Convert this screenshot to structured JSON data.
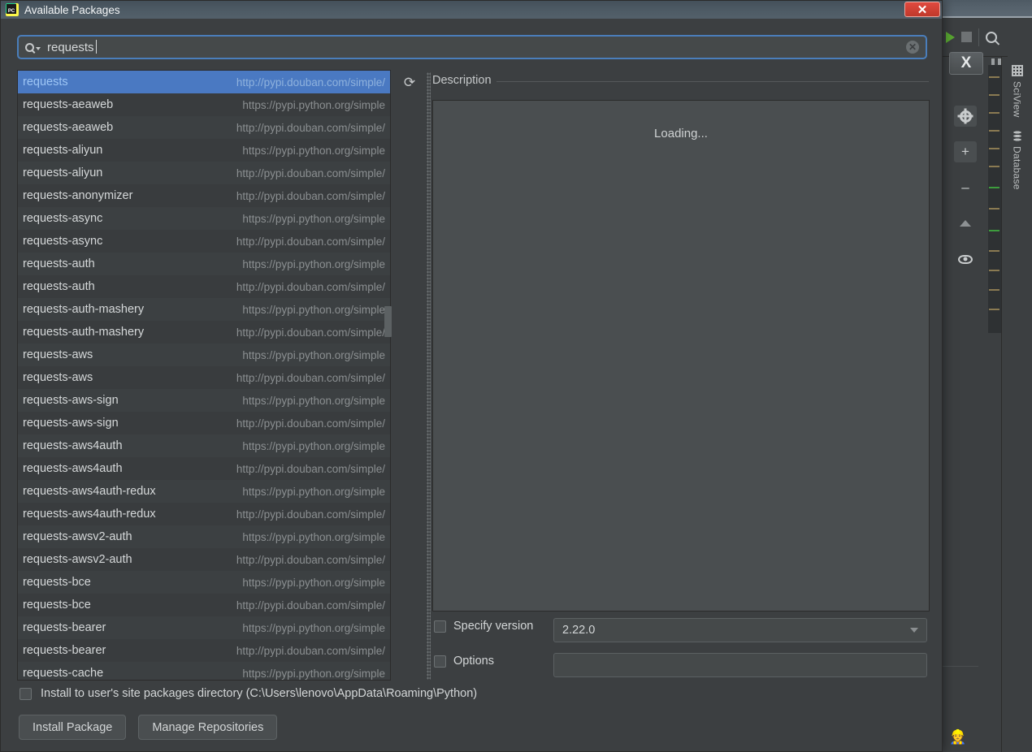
{
  "ide": {
    "right_tabs": [
      {
        "label": "SciView",
        "icon": "grid-icon"
      },
      {
        "label": "Database",
        "icon": "database-icon"
      }
    ],
    "toolbar_icons": [
      "run-icon",
      "stop-icon",
      "search-icon"
    ],
    "side_icons": [
      "gear-icon",
      "plus-icon",
      "minus-icon",
      "triangle-up-icon",
      "eye-icon"
    ],
    "close_tool_label": "X",
    "plus_label": "+",
    "minus_label": "–",
    "person_icon_label": "👷"
  },
  "dialog": {
    "title": "Available Packages",
    "app_icon": "pycharm-icon",
    "close_label": "✕"
  },
  "search": {
    "value": "requests",
    "icon": "search-icon",
    "clear_icon": "✕",
    "clear_label": "✕"
  },
  "list": {
    "refresh_icon": "⟳",
    "repos": {
      "douban": "http://pypi.douban.com/simple/",
      "pypi": "https://pypi.python.org/simple"
    },
    "selected_index": 0,
    "rows": [
      {
        "name": "requests",
        "repo": "http://pypi.douban.com/simple/"
      },
      {
        "name": "requests-aeaweb",
        "repo": "https://pypi.python.org/simple"
      },
      {
        "name": "requests-aeaweb",
        "repo": "http://pypi.douban.com/simple/"
      },
      {
        "name": "requests-aliyun",
        "repo": "https://pypi.python.org/simple"
      },
      {
        "name": "requests-aliyun",
        "repo": "http://pypi.douban.com/simple/"
      },
      {
        "name": "requests-anonymizer",
        "repo": "http://pypi.douban.com/simple/"
      },
      {
        "name": "requests-async",
        "repo": "https://pypi.python.org/simple"
      },
      {
        "name": "requests-async",
        "repo": "http://pypi.douban.com/simple/"
      },
      {
        "name": "requests-auth",
        "repo": "https://pypi.python.org/simple"
      },
      {
        "name": "requests-auth",
        "repo": "http://pypi.douban.com/simple/"
      },
      {
        "name": "requests-auth-mashery",
        "repo": "https://pypi.python.org/simple"
      },
      {
        "name": "requests-auth-mashery",
        "repo": "http://pypi.douban.com/simple/"
      },
      {
        "name": "requests-aws",
        "repo": "https://pypi.python.org/simple"
      },
      {
        "name": "requests-aws",
        "repo": "http://pypi.douban.com/simple/"
      },
      {
        "name": "requests-aws-sign",
        "repo": "https://pypi.python.org/simple"
      },
      {
        "name": "requests-aws-sign",
        "repo": "http://pypi.douban.com/simple/"
      },
      {
        "name": "requests-aws4auth",
        "repo": "https://pypi.python.org/simple"
      },
      {
        "name": "requests-aws4auth",
        "repo": "http://pypi.douban.com/simple/"
      },
      {
        "name": "requests-aws4auth-redux",
        "repo": "https://pypi.python.org/simple"
      },
      {
        "name": "requests-aws4auth-redux",
        "repo": "http://pypi.douban.com/simple/"
      },
      {
        "name": "requests-awsv2-auth",
        "repo": "https://pypi.python.org/simple"
      },
      {
        "name": "requests-awsv2-auth",
        "repo": "http://pypi.douban.com/simple/"
      },
      {
        "name": "requests-bce",
        "repo": "https://pypi.python.org/simple"
      },
      {
        "name": "requests-bce",
        "repo": "http://pypi.douban.com/simple/"
      },
      {
        "name": "requests-bearer",
        "repo": "https://pypi.python.org/simple"
      },
      {
        "name": "requests-bearer",
        "repo": "http://pypi.douban.com/simple/"
      },
      {
        "name": "requests-cache",
        "repo": "https://pypi.python.org/simple"
      }
    ]
  },
  "description": {
    "label": "Description",
    "content": "Loading..."
  },
  "version": {
    "checkbox_label": "Specify version",
    "checked": false,
    "selected": "2.22.0"
  },
  "options": {
    "checkbox_label": "Options",
    "checked": false,
    "value": ""
  },
  "site_packages": {
    "label": "Install to user's site packages directory (C:\\Users\\lenovo\\AppData\\Roaming\\Python)",
    "checked": false
  },
  "buttons": {
    "install": "Install Package",
    "manage": "Manage Repositories"
  },
  "colors": {
    "accent_selection": "#4a79c2",
    "window_bg": "#3c3f41",
    "close_red": "#c0392b",
    "focus_border": "#4a7ebb"
  }
}
